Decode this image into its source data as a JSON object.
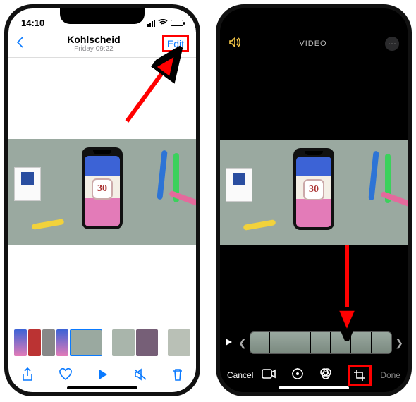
{
  "left": {
    "status": {
      "time": "14:10"
    },
    "header": {
      "title": "Kohlscheid",
      "subtitle": "Friday 09:22",
      "edit_label": "Edit"
    },
    "photo": {
      "badge_number": "30"
    },
    "toolbar": {
      "share": "share-icon",
      "favorite": "heart-icon",
      "play": "play-icon",
      "mute": "mute-icon",
      "delete": "trash-icon"
    }
  },
  "right": {
    "header": {
      "video_label": "VIDEO"
    },
    "photo": {
      "badge_number": "30"
    },
    "bottom": {
      "cancel_label": "Cancel",
      "done_label": "Done"
    }
  }
}
